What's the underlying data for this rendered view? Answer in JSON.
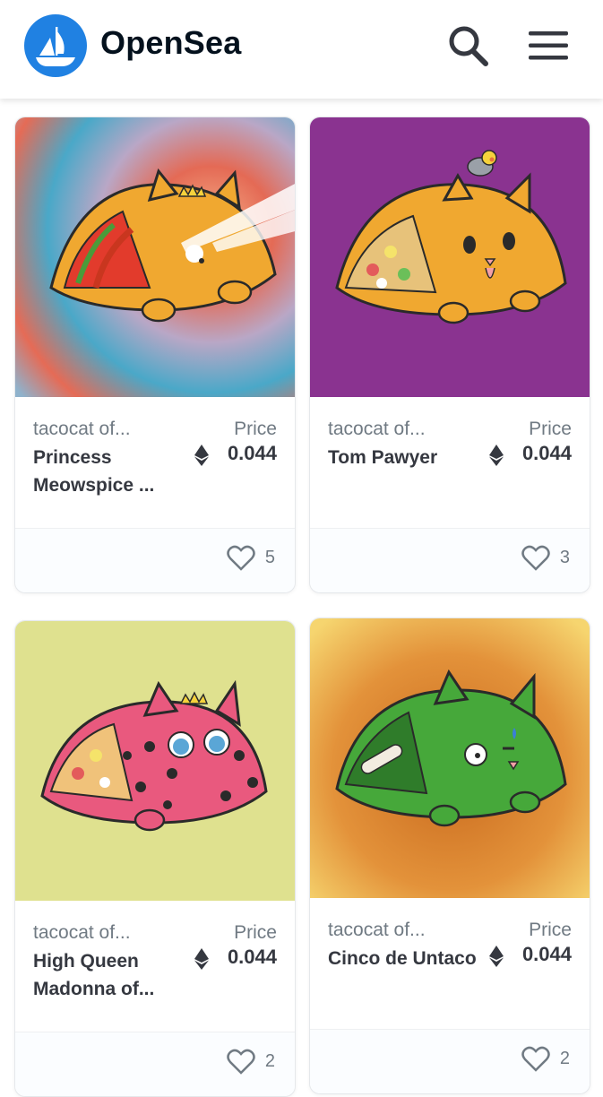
{
  "brand": {
    "name": "OpenSea"
  },
  "cards": [
    {
      "collection": "tacocat of...",
      "name": "Princess Meowspice ...",
      "price_label": "Price",
      "price": "0.044",
      "likes": "5"
    },
    {
      "collection": "tacocat of...",
      "name": "Tom Pawyer",
      "price_label": "Price",
      "price": "0.044",
      "likes": "3"
    },
    {
      "collection": "tacocat of...",
      "name": "High Queen Madonna of...",
      "price_label": "Price",
      "price": "0.044",
      "likes": "2"
    },
    {
      "collection": "tacocat of...",
      "name": "Cinco de Untaco",
      "price_label": "Price",
      "price": "0.044",
      "likes": "2"
    }
  ],
  "icons": {
    "logo": "opensea-logo-icon",
    "search": "search-icon",
    "menu": "hamburger-menu-icon",
    "currency": "ethereum-icon",
    "favorite": "heart-icon"
  },
  "colors": {
    "brand_blue": "#2081e2",
    "text_dark": "#353840",
    "text_muted": "#707a83"
  }
}
